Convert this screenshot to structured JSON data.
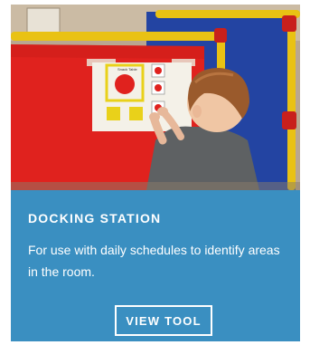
{
  "card": {
    "title": "DOCKING STATION",
    "description": "For use with daily schedules to identify areas in the room.",
    "button_label": "VIEW TOOL",
    "accent_color": "#3a8fc1"
  },
  "photo": {
    "board_heading": "Snack Table"
  }
}
